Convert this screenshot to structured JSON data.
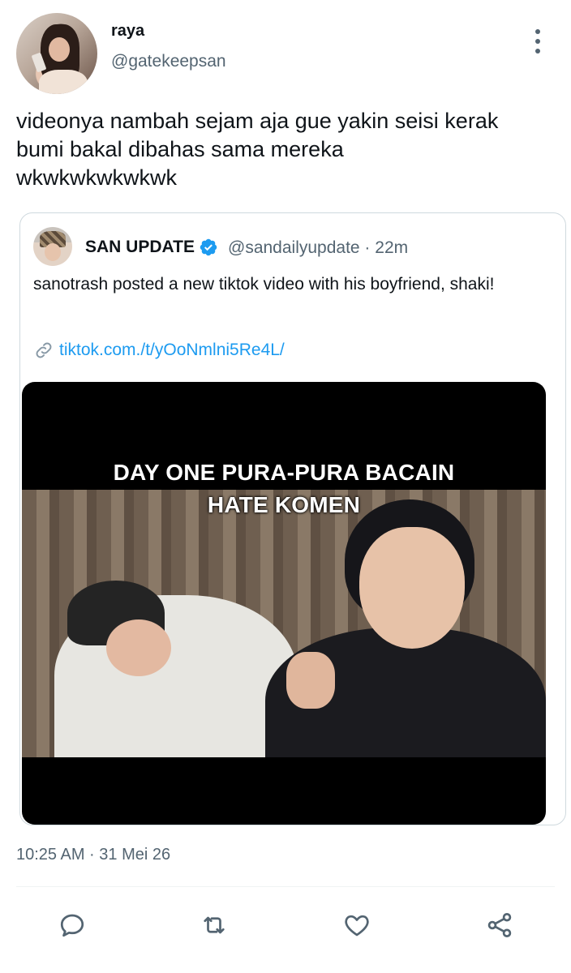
{
  "tweet": {
    "display_name": "raya",
    "handle": "@gatekeepsan",
    "text": "videonya nambah sejam aja gue yakin seisi kerak\nbumi bakal dibahas sama mereka\nwkwkwkwkwkwk",
    "timestamp": "10:25 AM · 31 Mei 26"
  },
  "quoted": {
    "display_name": "SAN UPDATE",
    "handle_time": "@sandailyupdate · 22m",
    "text": "sanotrash posted a new tiktok video with his boyfriend, shaki!",
    "link": "tiktok.com./t/yOoNmlni5Re4L/",
    "media_caption_line1": "DAY ONE PURA-PURA BACAIN",
    "media_caption_line2": "HATE KOMEN"
  },
  "icons": {
    "more": "more-vertical-icon",
    "verified": "verified-badge-icon",
    "link": "link-icon",
    "reply": "reply-icon",
    "retweet": "retweet-icon",
    "like": "heart-icon",
    "share": "share-icon"
  },
  "colors": {
    "text": "#0f1419",
    "secondary": "#536471",
    "link": "#1d9bf0",
    "verified": "#1d9bf0",
    "border": "#cfd9de"
  }
}
